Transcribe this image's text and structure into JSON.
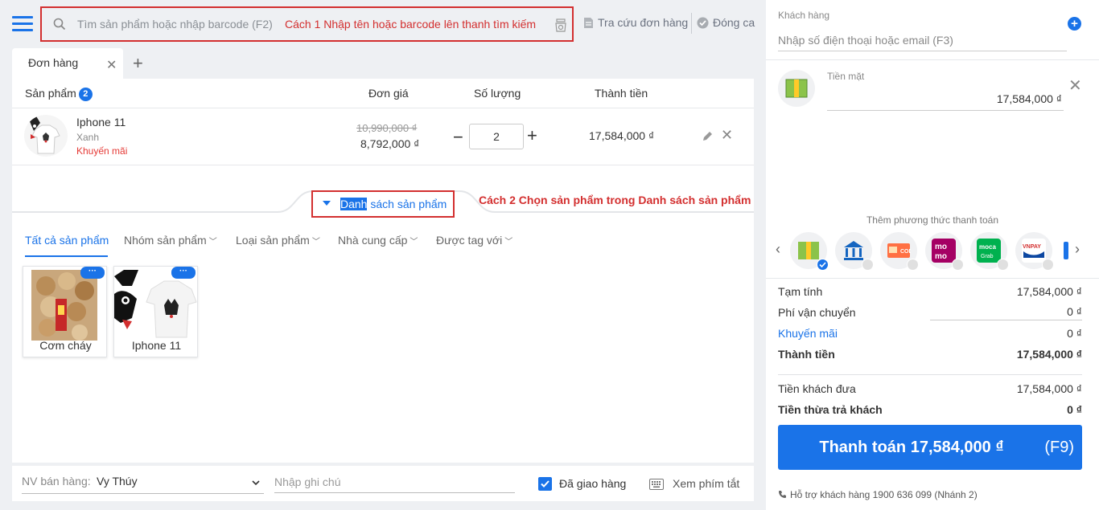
{
  "header": {
    "search_placeholder": "Tìm sản phẩm hoặc nhập barcode (F2)",
    "search_hint": "Cách 1 Nhập tên hoặc barcode lên thanh tìm kiếm",
    "lookup_label": "Tra cứu đơn hàng",
    "close_label": "Đóng ca"
  },
  "tabs": [
    {
      "label": "Đơn hàng"
    }
  ],
  "table": {
    "headers": {
      "product": "Sản phẩm",
      "count": "2",
      "price": "Đơn giá",
      "qty": "Số lượng",
      "total": "Thành tiền"
    },
    "rows": [
      {
        "name": "Iphone 11",
        "variant": "Xanh",
        "promo": "Khuyến mãi",
        "old_price": "10,990,000 ₫",
        "price": "8,792,000 ₫",
        "qty": "2",
        "total": "17,584,000 ₫"
      }
    ]
  },
  "product_list": {
    "toggle_label_hl": "Danh",
    "toggle_label_rest": " sách sản phẩm",
    "hint": "Cách 2 Chọn sản phẩm trong Danh sách sản phẩm",
    "filters": [
      "Tất cả sản phẩm",
      "Nhóm sản phẩm",
      "Loại sản phẩm",
      "Nhà cung cấp",
      "Được tag với"
    ],
    "items": [
      {
        "name": "Cơm cháy",
        "more": "···"
      },
      {
        "name": "Iphone 11",
        "more": "···"
      }
    ]
  },
  "footer": {
    "salesperson_label": "NV bán hàng:",
    "salesperson": "Vy Thúy",
    "note_placeholder": "Nhập ghi chú",
    "delivered_label": "Đã giao hàng",
    "shortcuts_label": "Xem phím tắt"
  },
  "customer": {
    "label": "Khách hàng",
    "placeholder": "Nhập số điện thoại hoặc email (F3)"
  },
  "payment": {
    "cash_label": "Tiền mặt",
    "cash_value": "17,584,000 ₫",
    "add_method_label": "Thêm phương thức thanh toán",
    "methods": [
      {
        "name": "Tiền mặt",
        "icon": "cash-icon",
        "selected": true
      },
      {
        "name": "Chuyển khoản",
        "icon": "bank-icon",
        "selected": false
      },
      {
        "name": "COD",
        "icon": "cod-icon",
        "selected": false
      },
      {
        "name": "MoMo",
        "icon": "momo-icon",
        "selected": false
      },
      {
        "name": "Moca",
        "icon": "moca-icon",
        "selected": false
      },
      {
        "name": "VNPAY",
        "icon": "vnpay-icon",
        "selected": false
      }
    ]
  },
  "summary": {
    "subtotal_label": "Tạm tính",
    "subtotal": "17,584,000 ₫",
    "shipping_label": "Phí vận chuyển",
    "shipping": "0 ₫",
    "discount_label": "Khuyến mãi",
    "discount": "0 ₫",
    "total_label": "Thành tiền",
    "total": "17,584,000 ₫",
    "paid_label": "Tiền khách đưa",
    "paid": "17,584,000 ₫",
    "change_label": "Tiền thừa trả khách",
    "change": "0 ₫"
  },
  "pay_button": {
    "label": "Thanh toán 17,584,000 ₫",
    "key": "(F9)"
  },
  "support": "Hỗ trợ khách hàng 1900 636 099 (Nhánh 2)",
  "colors": {
    "accent": "#1a73e8",
    "hint_red": "#d32f2f",
    "promo_red": "#e53935"
  }
}
